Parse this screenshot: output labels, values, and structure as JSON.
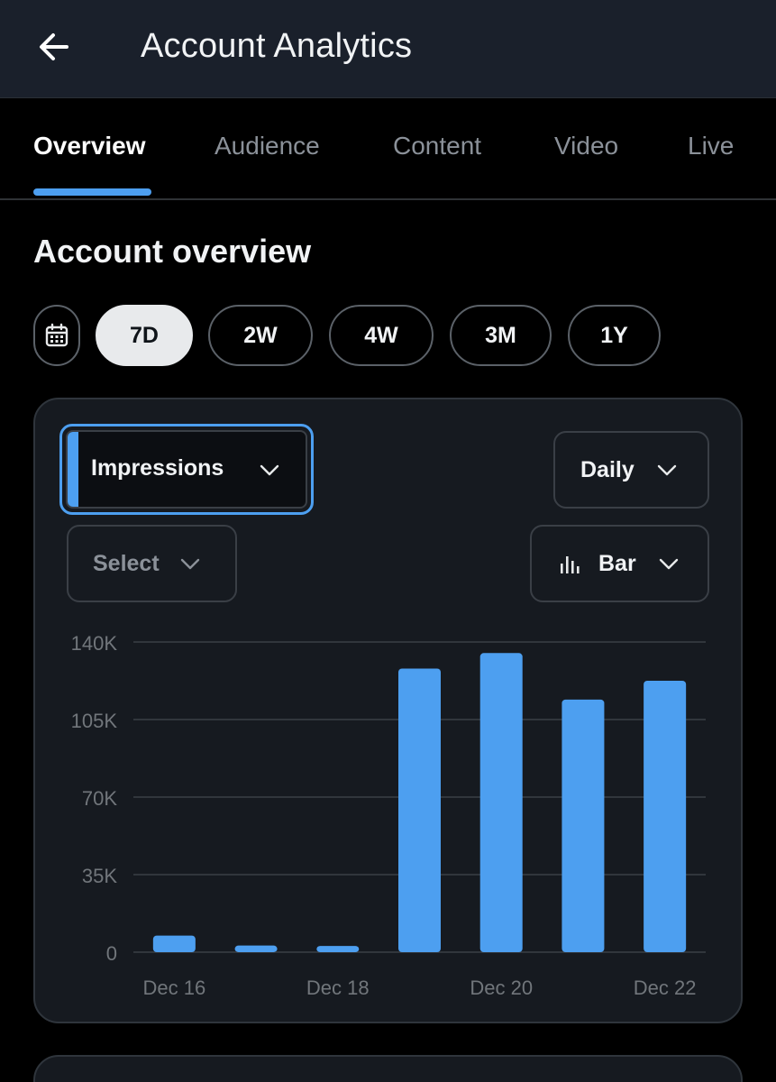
{
  "header": {
    "title": "Account Analytics",
    "back_icon": "arrow-left-icon"
  },
  "tabs": [
    {
      "label": "Overview",
      "active": true
    },
    {
      "label": "Audience",
      "active": false
    },
    {
      "label": "Content",
      "active": false
    },
    {
      "label": "Video",
      "active": false
    },
    {
      "label": "Live",
      "active": false
    }
  ],
  "section": {
    "title": "Account overview"
  },
  "ranges": {
    "calendar_icon": "calendar-icon",
    "options": [
      {
        "label": "7D",
        "active": true
      },
      {
        "label": "2W",
        "active": false
      },
      {
        "label": "4W",
        "active": false
      },
      {
        "label": "3M",
        "active": false
      },
      {
        "label": "1Y",
        "active": false
      }
    ]
  },
  "controls": {
    "metric": "Impressions",
    "compare": "Select",
    "interval": "Daily",
    "chart_type": "Bar",
    "chart_type_icon": "bar-chart-icon",
    "chevron_icon": "chevron-down-icon"
  },
  "colors": {
    "accent": "#4d9ff0",
    "bar": "#4d9ff0",
    "background": "#000000",
    "card": "#161a20",
    "header": "#1a202b"
  },
  "chart_data": {
    "type": "bar",
    "categories": [
      "Dec 16",
      "Dec 17",
      "Dec 18",
      "Dec 19",
      "Dec 20",
      "Dec 21",
      "Dec 22"
    ],
    "x_tick_labels": [
      "Dec 16",
      "Dec 18",
      "Dec 20",
      "Dec 22"
    ],
    "values": [
      7500,
      3000,
      2800,
      128000,
      135000,
      114000,
      122500
    ],
    "ylim": [
      0,
      140000
    ],
    "y_ticks": [
      0,
      35000,
      70000,
      105000,
      140000
    ],
    "y_tick_labels": [
      "0",
      "35K",
      "70K",
      "105K",
      "140K"
    ],
    "grid": true,
    "legend": "none"
  }
}
